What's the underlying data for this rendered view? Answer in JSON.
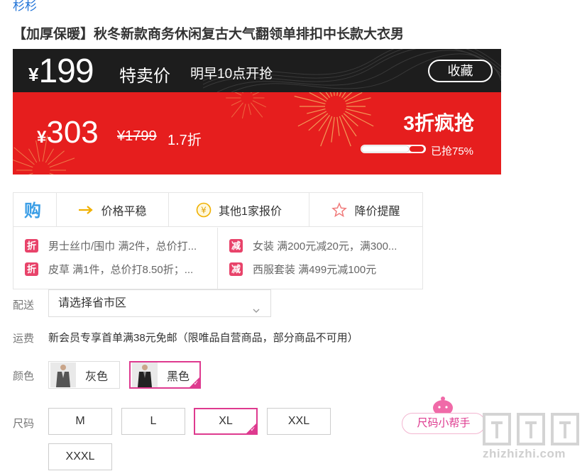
{
  "brand": "杉杉",
  "product_title": "【加厚保暖】秋冬新款商务休闲复古大气翻领单排扣中长款大衣男",
  "banner": {
    "sale_currency": "¥",
    "sale_price": "199",
    "sale_label": "特卖价",
    "sale_time": "明早10点开抢",
    "favorite_label": "收藏",
    "orig_currency": "¥",
    "orig_price": "303",
    "market_price": "¥1799",
    "discount": "1.7折",
    "promo": "3折疯抢",
    "progress_label": "已抢75%",
    "progress_fraction": 0.75,
    "colors": {
      "top": "#1d1d1d",
      "bottom": "#e61e1e"
    }
  },
  "tools": {
    "logo_icon": "buy-logo-icon",
    "items": [
      {
        "label": "价格平稳",
        "icon": "arrow-right-icon"
      },
      {
        "label": "其他1家报价",
        "icon": "yen-coin-icon"
      },
      {
        "label": "降价提醒",
        "icon": "star-icon"
      }
    ]
  },
  "coupons": [
    {
      "tag": "折",
      "text": "男士丝巾/围巾 满2件，总价打..."
    },
    {
      "tag": "减",
      "text": "女装 满200元减20元，满300..."
    },
    {
      "tag": "折",
      "text": "皮草 满1件，总价打8.50折；..."
    },
    {
      "tag": "减",
      "text": "西服套装 满499元减100元"
    }
  ],
  "delivery": {
    "label": "配送",
    "placeholder": "请选择省市区"
  },
  "shipping": {
    "label": "运费",
    "text": "新会员专享首单满38元免邮（限唯品自营商品，部分商品不可用）"
  },
  "color": {
    "label": "颜色",
    "options": [
      {
        "label": "灰色",
        "selected": false
      },
      {
        "label": "黑色",
        "selected": true
      }
    ]
  },
  "size": {
    "label": "尺码",
    "options": [
      {
        "label": "M",
        "selected": false
      },
      {
        "label": "L",
        "selected": false
      },
      {
        "label": "XL",
        "selected": true
      },
      {
        "label": "XXL",
        "selected": false
      },
      {
        "label": "XXXL",
        "selected": false
      }
    ]
  },
  "size_helper": "尺码小帮手",
  "watermark": "zhizhizhi.com",
  "accent_color": "#de3a8f"
}
